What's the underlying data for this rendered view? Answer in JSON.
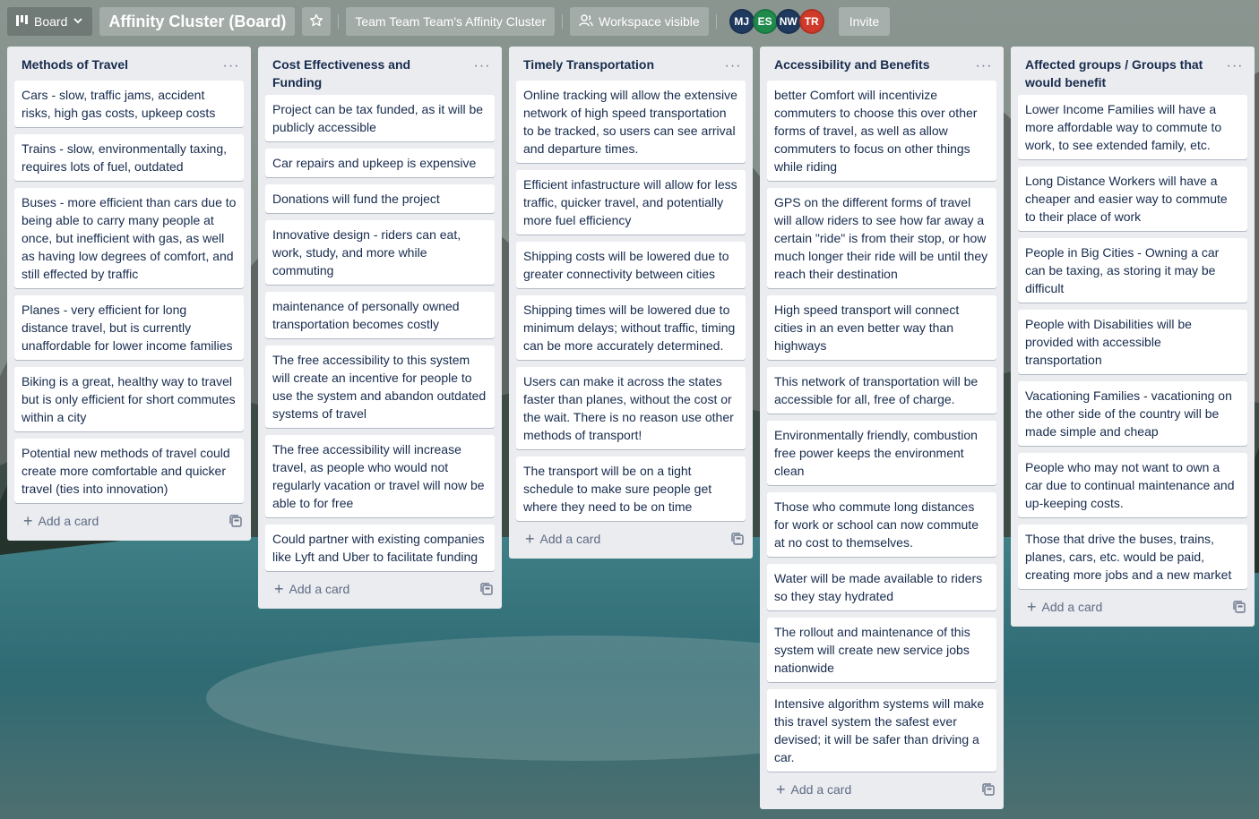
{
  "header": {
    "view_label": "Board",
    "board_title": "Affinity Cluster (Board)",
    "team_label": "Team Team Team's Affinity Cluster",
    "visibility_label": "Workspace visible",
    "invite_label": "Invite",
    "members": [
      {
        "initials": "MJ",
        "color": "#1f3a5f"
      },
      {
        "initials": "ES",
        "color": "#1f8a4c"
      },
      {
        "initials": "NW",
        "color": "#1f3a5f"
      },
      {
        "initials": "TR",
        "color": "#cf3a2a"
      }
    ]
  },
  "lists": [
    {
      "title": "Methods of Travel",
      "cards": [
        "Cars - slow, traffic jams, accident risks, high gas costs, upkeep costs",
        "Trains - slow, environmentally taxing, requires lots of fuel, outdated",
        "Buses - more efficient than cars due to being able to carry many people at once, but inefficient with gas, as well as having low degrees of comfort, and still effected by traffic",
        "Planes - very efficient for long distance travel, but is currently unaffordable for lower income families",
        "Biking is a great, healthy way to travel but is only efficient for short commutes within a city",
        "Potential new methods of travel could create more comfortable and quicker travel (ties into innovation)"
      ],
      "add_label": "Add a card"
    },
    {
      "title": "Cost Effectiveness and Funding",
      "cards": [
        "Project can be tax funded, as it will be publicly accessible",
        "Car repairs and upkeep is expensive",
        "Donations will fund the project",
        "Innovative design - riders can eat, work, study, and more while commuting",
        "maintenance of personally owned transportation becomes costly",
        "The free accessibility to this system will create an incentive for people to use the system and abandon outdated systems of travel",
        "The free accessibility will increase travel, as people who would not regularly vacation or travel will now be able to for free",
        "Could partner with existing companies like Lyft and Uber to facilitate funding"
      ],
      "add_label": "Add a card"
    },
    {
      "title": "Timely Transportation",
      "cards": [
        "Online tracking will allow the extensive network of high speed transportation to be tracked, so users can see arrival and departure times.",
        "Efficient infastructure will allow for less traffic, quicker travel, and potentially more fuel efficiency",
        "Shipping costs will be lowered due to greater connectivity between cities",
        "Shipping times will be lowered due to minimum delays; without traffic, timing can be more accurately determined.",
        "Users can make it across the states faster than planes, without the cost or the wait. There is no reason use other methods of transport!",
        "The transport will be on a tight schedule to make sure people get where they need to be on time"
      ],
      "add_label": "Add a card"
    },
    {
      "title": "Accessibility and Benefits",
      "cards": [
        "better Comfort will incentivize commuters to choose this over other forms of travel, as well as allow commuters to focus on other things while riding",
        "GPS on the different forms of travel will allow riders to see how far away a certain \"ride\" is from their stop, or how much longer their ride will be until they reach their destination",
        "High speed transport will connect cities in an even better way than highways",
        "This network of transportation will be accessible for all, free of charge.",
        "Environmentally friendly, combustion free power keeps the environment clean",
        "Those who commute long distances for work or school can now commute at no cost to themselves.",
        "Water will be made available to riders so they stay hydrated",
        "The rollout and maintenance of this system will create new service jobs nationwide",
        "Intensive algorithm systems will make this travel system the safest ever devised; it will be safer than driving a car."
      ],
      "add_label": "Add a card"
    },
    {
      "title": "Affected groups / Groups that would benefit",
      "cards": [
        "Lower Income Families will have a more affordable way to commute to work, to see extended family, etc.",
        "Long Distance Workers will have a cheaper and easier way to commute to their place of work",
        "People in Big Cities - Owning a car can be taxing, as storing it may be difficult",
        "People with Disabilities will be provided with accessible transportation",
        "Vacationing Families - vacationing on the other side of the country will be made simple and cheap",
        "People who may not want to own a car due to continual maintenance and up-keeping costs.",
        "Those that drive the buses, trains, planes, cars, etc. would be paid, creating more jobs and a new market"
      ],
      "add_label": "Add a card"
    }
  ]
}
